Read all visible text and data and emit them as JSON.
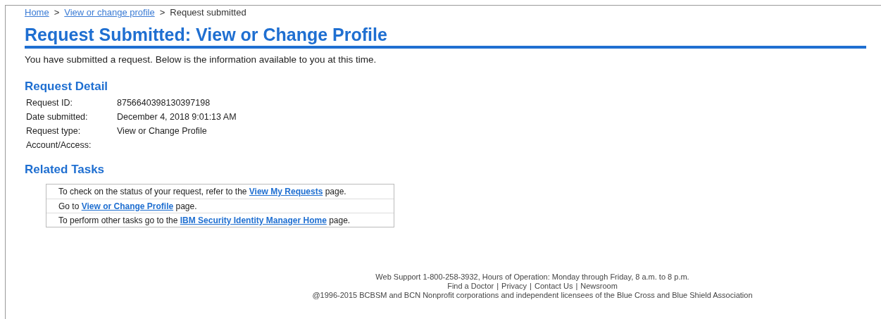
{
  "breadcrumbs": [
    {
      "label": "Home",
      "link": true
    },
    {
      "label": "View or change profile",
      "link": true
    },
    {
      "label": "Request submitted",
      "link": false
    }
  ],
  "breadcrumb_separator": ">",
  "title": "Request Submitted: View or Change Profile",
  "intro": "You have submitted a request. Below is the information available to you at this time.",
  "request_detail": {
    "heading": "Request Detail",
    "rows": [
      {
        "label": "Request ID:",
        "value": "8756640398130397198"
      },
      {
        "label": "Date submitted:",
        "value": "December 4, 2018 9:01:13 AM"
      },
      {
        "label": "Request type:",
        "value": "View or Change Profile"
      },
      {
        "label": "Account/Access:"
      }
    ]
  },
  "related_tasks": {
    "heading": "Related Tasks",
    "rows": [
      {
        "before": "To check on the status of your request, refer to the ",
        "link": "View My Requests",
        "after": " page."
      },
      {
        "before": "Go to ",
        "link": "View or Change Profile",
        "after": " page."
      },
      {
        "before": "To perform other tasks go to the ",
        "link": "IBM Security Identity Manager Home",
        "after": " page."
      }
    ]
  },
  "footer": {
    "support": "Web Support 1-800-258-3932, Hours of Operation: Monday through Friday, 8 a.m. to 8 p.m.",
    "links": [
      "Find a Doctor",
      "Privacy",
      "Contact Us",
      "Newsroom"
    ],
    "separator": "|",
    "copyright": "@1996-2015 BCBSM and BCN Nonprofit corporations and independent licensees of the Blue Cross and Blue Shield Association"
  }
}
